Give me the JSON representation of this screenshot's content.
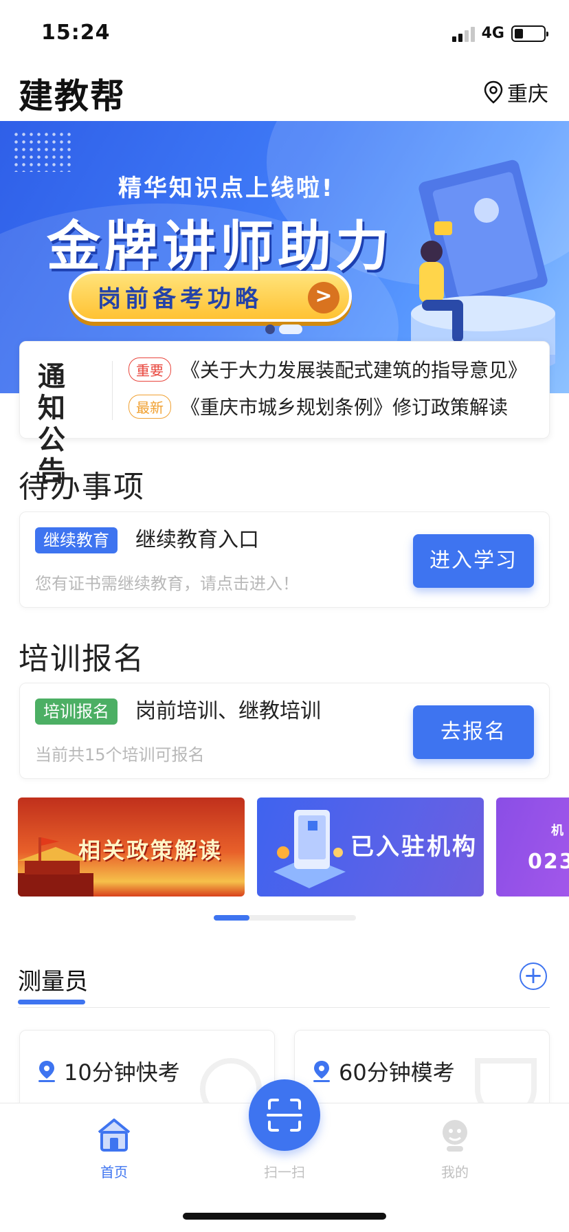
{
  "status_bar": {
    "time": "15:24",
    "network": "4G"
  },
  "header": {
    "app_title": "建教帮",
    "city": "重庆"
  },
  "banner": {
    "subtitle": "精华知识点上线啦!",
    "headline": "金牌讲师助力",
    "pill_text": "岗前备考功略",
    "pill_arrow": ">",
    "slide_count": 2,
    "active_slide": 1
  },
  "notice": {
    "label": "通知公告",
    "items": [
      {
        "tag": "重要",
        "text": "《关于大力发展装配式建筑的指导意见》"
      },
      {
        "tag": "最新",
        "text": "《重庆市城乡规划条例》修订政策解读"
      }
    ]
  },
  "todo": {
    "section_title": "待办事项",
    "badge": "继续教育",
    "title": "继续教育入口",
    "desc": "您有证书需继续教育，请点击进入！",
    "button": "进入学习"
  },
  "training": {
    "section_title": "培训报名",
    "badge": "培训报名",
    "title": "岗前培训、继教培训",
    "desc": "当前共15个培训可报名",
    "button": "去报名"
  },
  "promos": [
    {
      "text": "相关政策解读"
    },
    {
      "text": "已入驻机构"
    },
    {
      "text": "机",
      "text2": "023"
    }
  ],
  "category": {
    "title": "测量员",
    "plus": "+"
  },
  "quiz_cards": [
    {
      "title": "10分钟快考"
    },
    {
      "title": "60分钟模考"
    }
  ],
  "tabbar": {
    "items": [
      {
        "label": "首页",
        "active": true
      },
      {
        "label": "扫一扫",
        "active": false
      },
      {
        "label": "我的",
        "active": false
      }
    ]
  },
  "colors": {
    "primary": "#3e74f0",
    "badge_blue": "#3e74f0",
    "badge_green": "#4caf64",
    "tag_red": "#e8453c",
    "tag_orange": "#f0a030",
    "inactive": "#c0c0c0"
  }
}
